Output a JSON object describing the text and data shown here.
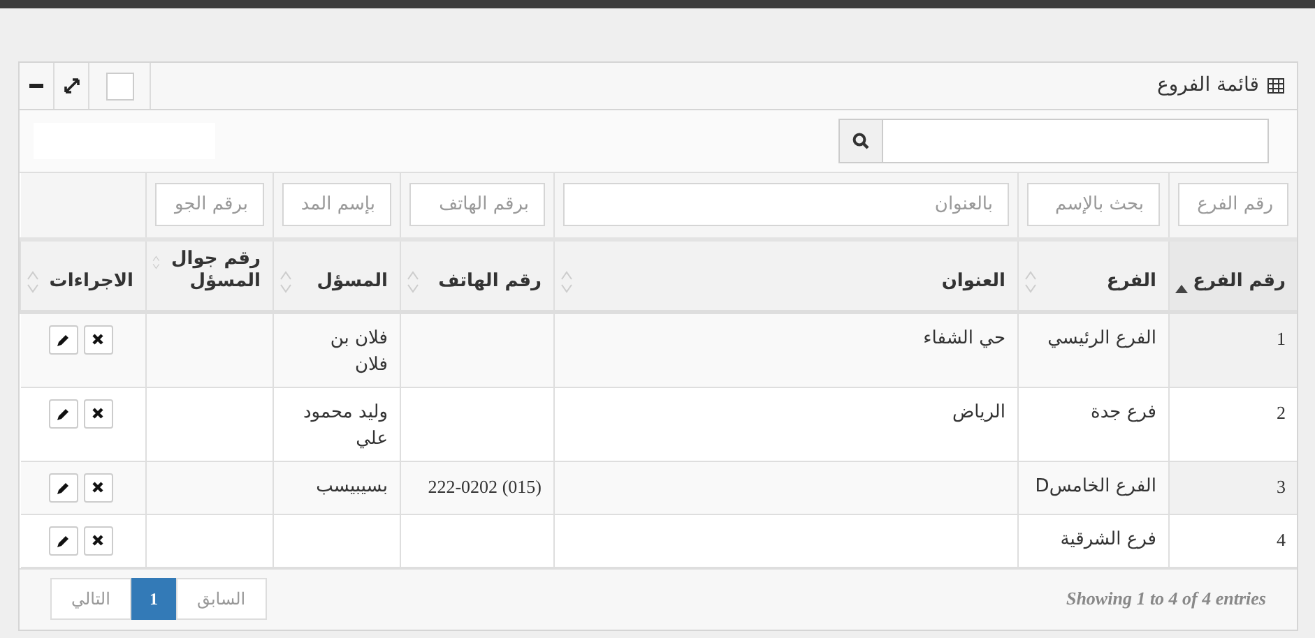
{
  "panel": {
    "title": "قائمة الفروع",
    "checked": false
  },
  "filters": [
    {
      "placeholder": "رقم الفرع"
    },
    {
      "placeholder": "بحث بالإسم"
    },
    {
      "placeholder": "بالعنوان"
    },
    {
      "placeholder": "برقم الهاتف"
    },
    {
      "placeholder": "بإسم المد"
    },
    {
      "placeholder": "برقم الجو"
    }
  ],
  "table": {
    "columns": [
      {
        "label": "رقم الفرع",
        "sorted": true
      },
      {
        "label": "الفرع",
        "sorted": false
      },
      {
        "label": "العنوان",
        "sorted": false
      },
      {
        "label": "رقم الهاتف",
        "sorted": false
      },
      {
        "label": "المسؤل",
        "sorted": false
      },
      {
        "label": "رقم جوال المسؤل",
        "sorted": false
      },
      {
        "label": "الاجراءات",
        "sorted": false
      }
    ],
    "rows": [
      {
        "cells": [
          "1",
          "الفرع الرئيسي",
          "حي الشفاء",
          "",
          "فلان بن فلان",
          ""
        ]
      },
      {
        "cells": [
          "2",
          "فرع جدة",
          "الرياض",
          "",
          "وليد محمود علي",
          ""
        ]
      },
      {
        "cells": [
          "3",
          "الفرع الخامسD",
          "",
          "(015) 222-0202",
          "بسيبيسب",
          ""
        ]
      },
      {
        "cells": [
          "4",
          "فرع الشرقية",
          "",
          "",
          "",
          ""
        ]
      }
    ]
  },
  "footer": {
    "info": "Showing 1 to 4 of 4 entries",
    "pages": [
      {
        "label": "السابق",
        "kind": "nav",
        "disabled": true,
        "selected": false
      },
      {
        "label": "1",
        "kind": "page",
        "selected": true
      },
      {
        "label": "التالي",
        "kind": "nav",
        "disabled": true,
        "selected": false
      }
    ]
  }
}
